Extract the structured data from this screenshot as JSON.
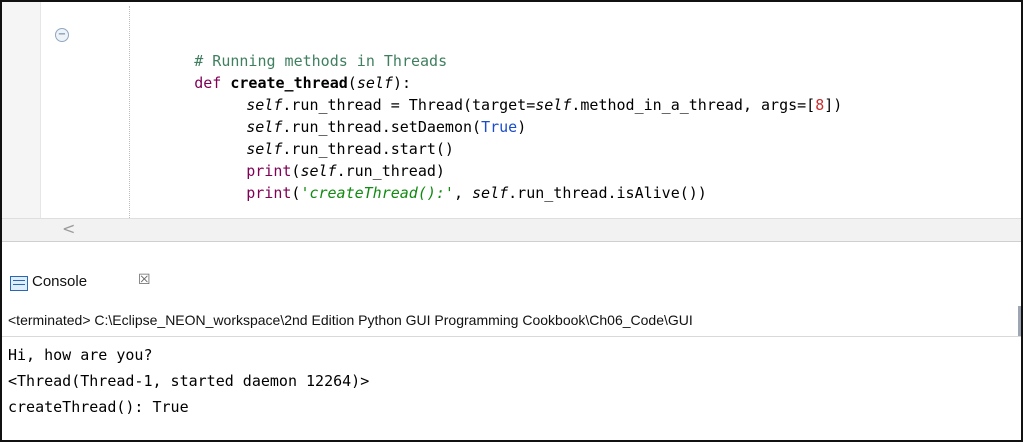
{
  "editor": {
    "comment": "# Running methods in Threads",
    "def_kw": "def",
    "def_name": "create_thread",
    "self_kw": "self",
    "line2_part1": ".run_thread = Thread(target=",
    "line2_part2": ".method_in_a_thread, args=[",
    "line2_num": "8",
    "line2_end": "])",
    "line3_prefix": ".run_thread.setDaemon(",
    "line3_true": "True",
    "line3_end": ")",
    "line4": ".run_thread.start()",
    "print_kw": "print",
    "line5_inner": "(",
    "line5_end": ".run_thread)",
    "line6_str": "'createThread():'",
    "line6_mid": ", ",
    "line6_end": ".run_thread.isAlive())",
    "fold_icon": "minus"
  },
  "scroll": {
    "left_glyph": "<"
  },
  "console": {
    "tab_label": "Console",
    "tab_close": "☒",
    "status": "<terminated> C:\\Eclipse_NEON_workspace\\2nd Edition Python GUI Programming Cookbook\\Ch06_Code\\GUI",
    "lines": [
      "Hi, how are you?",
      "<Thread(Thread-1, started daemon 12264)>",
      "createThread(): True"
    ]
  }
}
